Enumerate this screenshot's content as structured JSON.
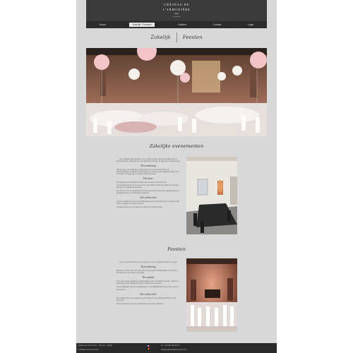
{
  "header": {
    "logo_line1": "CHÂTEAU DE L'ARMONIÈRE",
    "logo_line2": "aqua",
    "logo_line3": "gastronomie"
  },
  "nav": {
    "items": [
      "Home",
      "Zakelijk / Feesten",
      "Kasteel",
      "Contact",
      "Login"
    ],
    "active_index": 1
  },
  "tabs": {
    "left": "Zakelijk",
    "right": "Feesten"
  },
  "section1": {
    "title": "Zakelijke evenementen",
    "intro": "Voor zakelijke bijeenkomsten kunt u zowel op grote als kleinere zalen van het kasteel rekenen, aangepast aan het aantal deelnemers, de gewenste ondersteuning.",
    "sub1": "De benadering",
    "p1": "Wij zijn ervan overtuigd dat een bijeenkomst in een kasteel slechts een gedenkwaardige en efficiënte beleving kan zijn, wanneer alle praktische zaken tot in de puntjes verzorgd zijn en iedereen zich goed voelt.",
    "sub2": "Het diner",
    "p2": "Een bijeenkomst eindigt bij voorkeur met een diner. Onze chef stelt seizoensgebonden menu's samen met verse lokale producten waarbij we rekening houden met speciale dieetwensen.",
    "p2b": "Een diner in onze ontvangstzaal of op het terras biedt de perfecte afsluiting van een geslaagde dag, in een sfeervolle omgeving.",
    "sub3": "Het cadeau-idee",
    "p3": "Verras uw gasten met een persoonlijk geschenk als aandenken aan het kasteel. Wij helpen u graag met originele ideeën.",
    "p3b": "Contacteer ons voor een offerte op maat van uw bijeenkomst."
  },
  "section2": {
    "title": "Feesten",
    "intro": "Voor uw grote en kleine feesten, die bij ons tot in de puntjes worden verzorgd.",
    "sub1": "De benadering",
    "p1": "Elk feest is uniek. Van een intiem diner tot een groots huwelijksfeest: wij stemmen elk detail af op uw wensen en budget.",
    "sub2": "Het aanbod",
    "p2": "Onze zalen bieden plaats aan gezelschappen van verschillende grootte. Keuken en bediening worden afgestemd op het programma van de dag.",
    "p2b": "Vraag vrijblijvend naar de mogelijkheden en beschikbaarheid van de zalen voor uw evenement.",
    "sub3": "Het cadeau-idee",
    "p3": "Een verblijf, diner of arrangement op het kasteel is een geschenk dat lang wordt herinnerd.",
    "p3b": "Neem contact op met onze medewerkers voor meer informatie."
  },
  "footer": {
    "address": "Château de l'Armonière · Tervuren · België",
    "copyright": "© Château de l'Armonière",
    "phone": "tel. +32 (0)2 123 45 67",
    "email": "info@chateaudelarmoniere.com"
  },
  "colors": {
    "header_bg": "#3a3a3a",
    "nav_bg": "#2b2b2b",
    "column_bg": "#d8d8d8",
    "footer_bg": "#2a2a2a",
    "balloon_pink": "#f2c4c8",
    "balloon_white": "#f4f0ea"
  }
}
